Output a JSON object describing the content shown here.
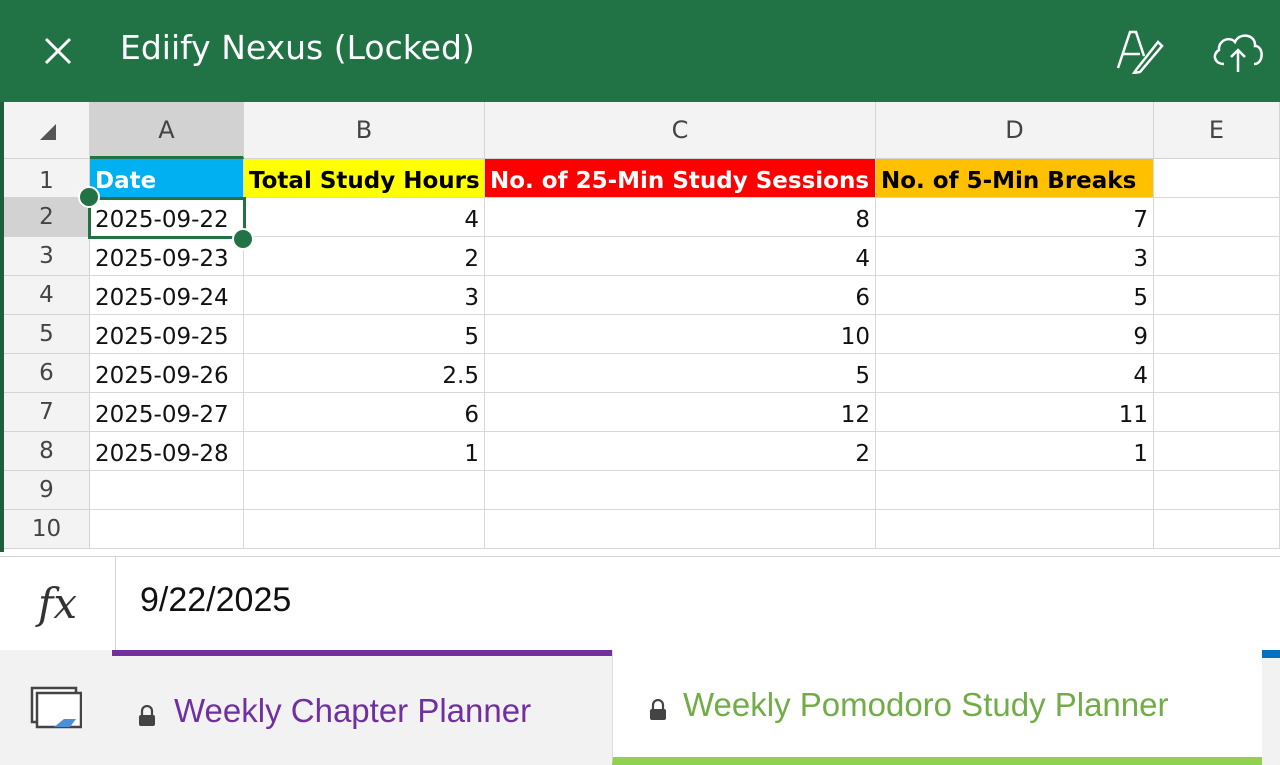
{
  "app": {
    "title": "Ediify Nexus (Locked)",
    "accent": "#217346"
  },
  "icons": {
    "close": "close-icon",
    "pen": "draw-pen-icon",
    "cloud": "cloud-upload-icon",
    "sheets": "sheets-list-icon",
    "lock": "lock-icon"
  },
  "sheet": {
    "columns": [
      "A",
      "B",
      "C",
      "D",
      "E"
    ],
    "rows": [
      "1",
      "2",
      "3",
      "4",
      "5",
      "6",
      "7",
      "8",
      "9",
      "10"
    ],
    "headers": {
      "date": "Date",
      "hours": "Total Study Hours",
      "sessions": "No. of 25-Min Study Sessions",
      "breaks": "No. of 5-Min Breaks"
    },
    "header_colors": {
      "date": "#00b0f0",
      "hours": "#ffff00",
      "sessions": "#ff0000",
      "breaks": "#ffc000"
    },
    "data": [
      {
        "date": "2025-09-22",
        "hours": "4",
        "sessions": "8",
        "breaks": "7"
      },
      {
        "date": "2025-09-23",
        "hours": "2",
        "sessions": "4",
        "breaks": "3"
      },
      {
        "date": "2025-09-24",
        "hours": "3",
        "sessions": "6",
        "breaks": "5"
      },
      {
        "date": "2025-09-25",
        "hours": "5",
        "sessions": "10",
        "breaks": "9"
      },
      {
        "date": "2025-09-26",
        "hours": "2.5",
        "sessions": "5",
        "breaks": "4"
      },
      {
        "date": "2025-09-27",
        "hours": "6",
        "sessions": "12",
        "breaks": "11"
      },
      {
        "date": "2025-09-28",
        "hours": "1",
        "sessions": "2",
        "breaks": "1"
      }
    ],
    "selected_cell": "A2"
  },
  "formula_bar": {
    "fx_label": "fx",
    "value": "9/22/2025"
  },
  "tabs": [
    {
      "label": "Weekly Chapter Planner",
      "color": "#7030a0",
      "active": false
    },
    {
      "label": "Weekly Pomodoro Study Planner",
      "color": "#70ad47",
      "active": true
    }
  ]
}
